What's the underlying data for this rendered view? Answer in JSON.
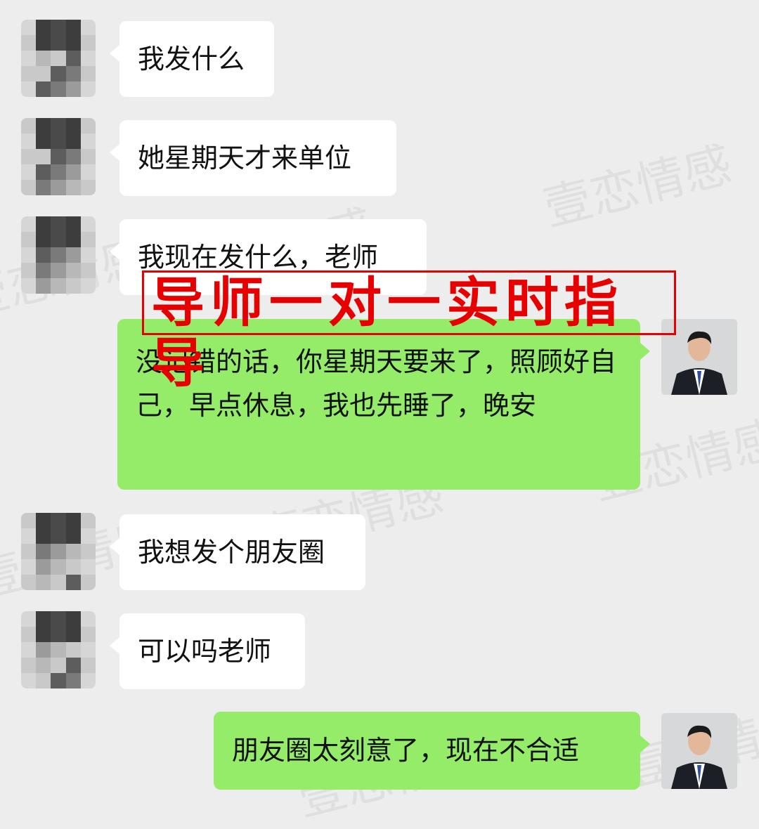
{
  "watermark": "壹恋情感",
  "banner": "导师一对一实时指导",
  "messages": [
    {
      "side": "in",
      "text": "我发什么"
    },
    {
      "side": "in",
      "text": "她星期天才来单位"
    },
    {
      "side": "in",
      "text": "我现在发什么，老师"
    },
    {
      "side": "out",
      "text": "没记错的话，你星期天要来了，照顾好自己，早点休息，我也先睡了，晚安"
    },
    {
      "side": "in",
      "text": "我想发个朋友圈"
    },
    {
      "side": "in",
      "text": "可以吗老师"
    },
    {
      "side": "out",
      "text": "朋友圈太刻意了，现在不合适"
    }
  ]
}
